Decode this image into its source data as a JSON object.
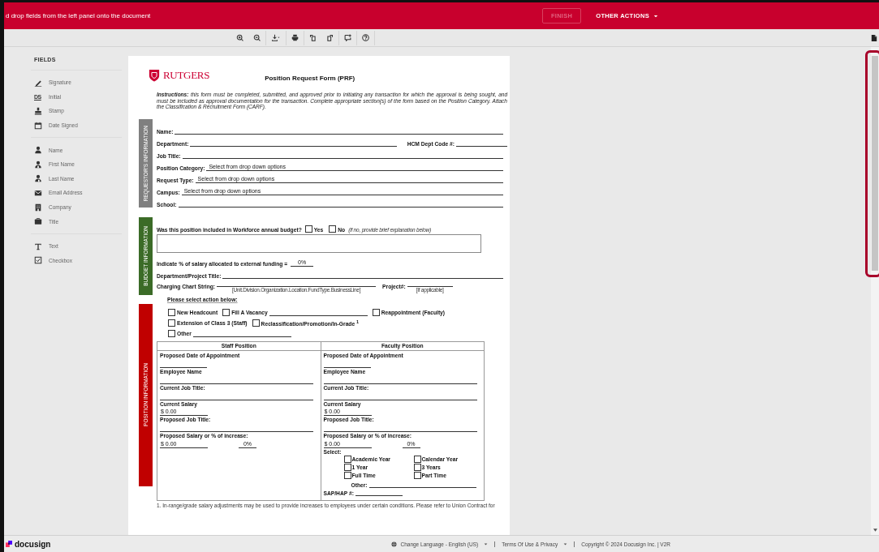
{
  "top_bar": {
    "message": "d drop fields from the left panel onto the document",
    "finish": {
      "label": "FINISH",
      "disabled": true
    },
    "other_actions": "OTHER ACTIONS"
  },
  "sidebar": {
    "title": "FIELDS",
    "groups": [
      {
        "items": [
          {
            "label": "Signature"
          },
          {
            "label": "Initial",
            "glyph": "DS"
          },
          {
            "label": "Stamp"
          },
          {
            "label": "Date Signed"
          }
        ]
      },
      {
        "items": [
          {
            "label": "Name"
          },
          {
            "label": "First Name"
          },
          {
            "label": "Last Name"
          },
          {
            "label": "Email Address"
          },
          {
            "label": "Company"
          },
          {
            "label": "Title"
          }
        ]
      },
      {
        "items": [
          {
            "label": "Text"
          },
          {
            "label": "Checkbox"
          }
        ]
      }
    ]
  },
  "document": {
    "brand": "RUTGERS",
    "title": "Position Request Form (PRF)",
    "instructions": "**Instructions:** this form must be completed, submitted, and approved prior to initiating any transaction for which the approval is being sought, and must be included as approval documentation for the transaction. Complete appropriate section(s) of the form based on the Position Category.  Attach the Classification & Recruitment Form (CARF).",
    "sections": [
      {
        "label": "REQUESTOR'S INFORMATION",
        "color": "#7f7f7f",
        "rows": [
          {
            "kind": "field",
            "label": "Name:"
          },
          {
            "kind": "field",
            "label": "Department:",
            "extra_label": "HCM Dept Code #:"
          },
          {
            "kind": "field",
            "label": "Job Title:"
          },
          {
            "kind": "field",
            "label": "Position Category:",
            "value": "Select from drop down options"
          },
          {
            "kind": "field",
            "label": "Request Type:",
            "value": "Select from drop down options"
          },
          {
            "kind": "field",
            "label": "Campus:",
            "value": "Select from drop down options"
          },
          {
            "kind": "field",
            "label": "School:"
          }
        ]
      },
      {
        "label": "BUDGET INFORMATION",
        "color": "#3b6b27",
        "rows": [
          {
            "kind": "question",
            "label": "Was this position included in Workforce annual budget?",
            "options": [
              {
                "label": "Yes",
                "checked": false
              },
              {
                "label": "No",
                "checked": false
              }
            ],
            "note": "(if no, provide brief explanation below)"
          },
          {
            "kind": "textbox"
          },
          {
            "kind": "field",
            "label": "Indicate % of salary allocated to external funding =",
            "value": "0%"
          },
          {
            "kind": "field",
            "label": "Department/Project Title:"
          },
          {
            "kind": "charging",
            "label": "Charging Chart String:",
            "hint": "[Unit.Division.Organization.Location.FundType.BusinessLine]",
            "extra_label": "Project#:",
            "extra_hint": "[If applicable]"
          }
        ]
      },
      {
        "label": "POSITION INFORMATION",
        "color": "#c00000",
        "heading": "Please select action below:",
        "check_rows": [
          [
            {
              "label": "New Headcount",
              "checked": false
            },
            {
              "label": "Fill A Vacancy",
              "checked": false,
              "blank": true
            },
            {
              "label": "Reappointment (Faculty)",
              "checked": false
            }
          ],
          [
            {
              "label": "Extension of Class 3 (Staff)",
              "checked": false
            },
            {
              "label": "Reclassification/Promotion/In-Grade $^{1}$",
              "checked": false
            }
          ],
          [
            {
              "label": "Other",
              "checked": false,
              "blank": true
            }
          ]
        ],
        "table": {
          "columns": [
            {
              "title": "Staff Position",
              "items": [
                {
                  "kind": "label",
                  "text": "Proposed Date of Appointment"
                },
                {
                  "kind": "blank"
                },
                {
                  "kind": "label",
                  "text": "Employee Name"
                },
                {
                  "kind": "blank"
                },
                {
                  "kind": "label",
                  "text": "Current Job Title:"
                },
                {
                  "kind": "blank"
                },
                {
                  "kind": "label",
                  "text": "Current Salary"
                },
                {
                  "kind": "amount",
                  "text": "$ 0.00"
                },
                {
                  "kind": "label",
                  "text": "Proposed Job Title:"
                },
                {
                  "kind": "blank"
                },
                {
                  "kind": "label",
                  "text": "Proposed Salary or % of increase:"
                },
                {
                  "kind": "pair",
                  "values": [
                    "$ 0.00",
                    "0%"
                  ]
                }
              ]
            },
            {
              "title": "Faculty Position",
              "items": [
                {
                  "kind": "label",
                  "text": "Proposed Date of Appointment"
                },
                {
                  "kind": "blank"
                },
                {
                  "kind": "label",
                  "text": "Employee Name"
                },
                {
                  "kind": "blank"
                },
                {
                  "kind": "label",
                  "text": "Current Job Title:"
                },
                {
                  "kind": "blank"
                },
                {
                  "kind": "label",
                  "text": "Current Salary"
                },
                {
                  "kind": "amount",
                  "text": "$ 0.00"
                },
                {
                  "kind": "label",
                  "text": "Proposed Job Title:"
                },
                {
                  "kind": "blank"
                },
                {
                  "kind": "label",
                  "text": "Proposed Salary or % of increase:"
                },
                {
                  "kind": "pair",
                  "values": [
                    "$ 0.00",
                    "0%"
                  ]
                },
                {
                  "kind": "label",
                  "text": "Select:"
                },
                {
                  "kind": "checks",
                  "options": [
                    {
                      "label": "Academic Year",
                      "checked": false
                    },
                    {
                      "label": "Calendar Year",
                      "checked": false
                    },
                    {
                      "label": "1 Year",
                      "checked": false
                    },
                    {
                      "label": "3  Years",
                      "checked": false
                    },
                    {
                      "label": "Full Time",
                      "checked": false
                    },
                    {
                      "label": "Part Time",
                      "checked": false
                    }
                  ]
                },
                {
                  "kind": "other",
                  "text": "Other:"
                },
                {
                  "kind": "field",
                  "text": "SAP/HAP #:"
                }
              ]
            }
          ]
        }
      }
    ],
    "footnote": "1.   In-range/grade salary adjustments may be used to provide increases to employees under certain conditions. Please refer to Union Contract for"
  },
  "footer": {
    "brand": "docusign",
    "language": "Change Language - English (US)",
    "terms": "Terms Of Use & Privacy",
    "copyright": "Copyright © 2024 Docusign Inc. | V2R"
  }
}
